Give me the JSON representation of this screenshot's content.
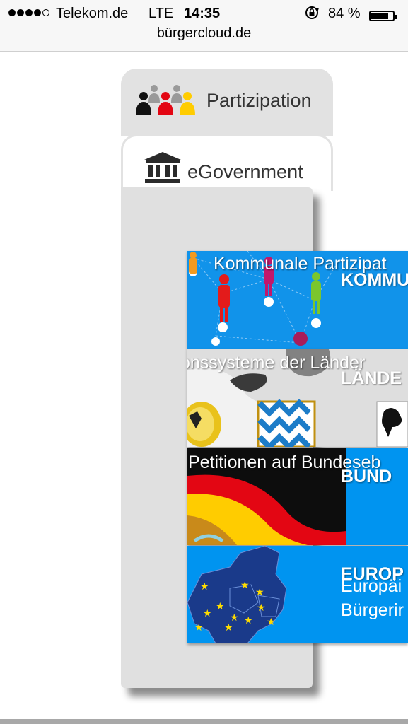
{
  "status_bar": {
    "carrier": "Telekom.de",
    "network": "LTE",
    "time": "14:35",
    "battery_text": "84 %",
    "battery_level": 0.84,
    "icons": [
      "signal-dots-icon",
      "rotation-lock-icon",
      "battery-icon"
    ]
  },
  "browser": {
    "url": "bürgercloud.de"
  },
  "tabs": [
    {
      "label": "Partizipation",
      "icon": "people-group-icon"
    },
    {
      "label": "eGovernment",
      "icon": "government-building-icon"
    }
  ],
  "tiles": [
    {
      "overlay": "Kommunale Partizipat",
      "heading": "KOMMU"
    },
    {
      "overlay": "onssysteme der Länder",
      "heading": "LÄNDE"
    },
    {
      "overlay": "Petitionen auf Bundeseb",
      "heading": "BUND"
    },
    {
      "heading": "EUROP",
      "line1": "Europäi",
      "line2": "Bürgerir"
    }
  ],
  "colors": {
    "tile_blue": "#0094f0",
    "panel_gray": "#e0e0e0",
    "german_black": "#111111",
    "german_red": "#e30613",
    "german_gold": "#ffcc00"
  }
}
